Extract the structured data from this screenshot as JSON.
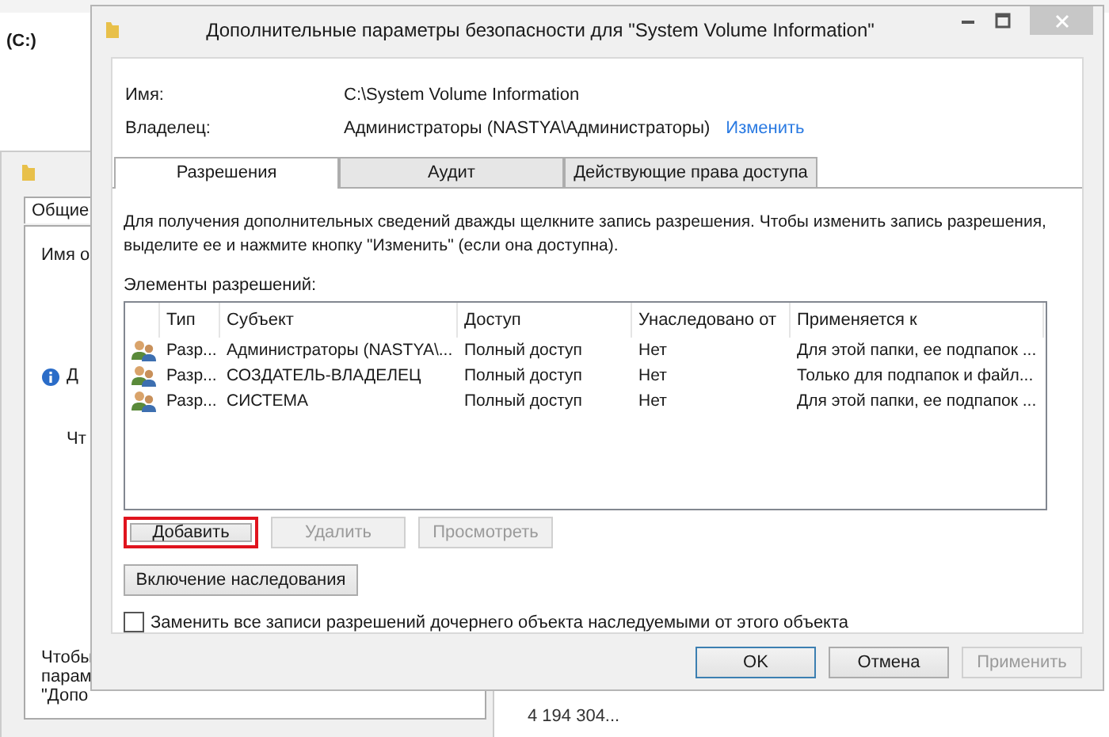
{
  "background": {
    "drive_label": "(C:)",
    "properties_dialog": {
      "tab": "Общие",
      "name_label": "Имя о",
      "item_labels": [
        "Д",
        "Чт"
      ],
      "note_lines": [
        "Чтобы",
        "парам",
        "\"Допо"
      ]
    },
    "size_value": "4 194 304..."
  },
  "dialog": {
    "title": "Дополнительные параметры безопасности  для \"System Volume Information\"",
    "fields": [
      {
        "label": "Имя:",
        "value": "C:\\System Volume Information"
      },
      {
        "label": "Владелец:",
        "value": "Администраторы (NASTYA\\Администраторы)",
        "link": "Изменить"
      }
    ],
    "tabs": [
      {
        "label": "Разрешения",
        "selected": true
      },
      {
        "label": "Аудит",
        "selected": false
      },
      {
        "label": "Действующие права доступа",
        "selected": false
      }
    ],
    "description": "Для получения дополнительных сведений дважды щелкните запись разрешения. Чтобы изменить запись разрешения, выделите ее и нажмите кнопку \"Изменить\" (если она доступна).",
    "list_label": "Элементы разрешений:",
    "table": {
      "columns": [
        "Тип",
        "Субъект",
        "Доступ",
        "Унаследовано от",
        "Применяется к"
      ],
      "rows": [
        {
          "cells": [
            "Разр...",
            "Администраторы (NASTYA\\...",
            "Полный доступ",
            "Нет",
            "Для этой папки, ее подпапок ..."
          ]
        },
        {
          "cells": [
            "Разр...",
            "СОЗДАТЕЛЬ-ВЛАДЕЛЕЦ",
            "Полный доступ",
            "Нет",
            "Только для подпапок и файл..."
          ]
        },
        {
          "cells": [
            "Разр...",
            "СИСТЕМА",
            "Полный доступ",
            "Нет",
            "Для этой папки, ее подпапок ..."
          ]
        }
      ]
    },
    "actions": [
      {
        "label": "Добавить",
        "disabled": false,
        "highlighted": true
      },
      {
        "label": "Удалить",
        "disabled": true,
        "highlighted": false
      },
      {
        "label": "Просмотреть",
        "disabled": true,
        "highlighted": false
      }
    ],
    "inherit_button": "Включение наследования",
    "replace_checkbox": {
      "label": "Заменить все записи разрешений дочернего объекта наследуемыми от этого объекта",
      "checked": false
    },
    "buttons": [
      {
        "label": "OK",
        "disabled": false,
        "default": true
      },
      {
        "label": "Отмена",
        "disabled": false,
        "default": false
      },
      {
        "label": "Применить",
        "disabled": true,
        "default": false
      }
    ]
  }
}
